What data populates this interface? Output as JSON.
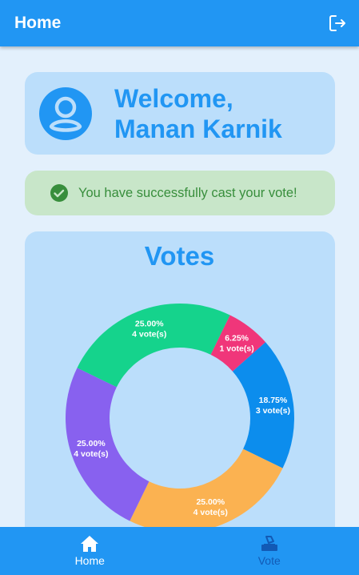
{
  "appbar": {
    "title": "Home",
    "logout_icon": "logout-icon"
  },
  "welcome": {
    "line1": "Welcome,",
    "line2": "Manan Karnik",
    "avatar_icon": "account-circle-icon"
  },
  "status": {
    "message": "You have successfully cast your vote!",
    "icon": "check-circle-icon"
  },
  "votes": {
    "title": "Votes"
  },
  "chart_data": {
    "type": "pie",
    "slices": [
      {
        "percent_label": "25.00%",
        "votes_label": "4 vote(s)",
        "value": 4,
        "color": "#15d38c"
      },
      {
        "percent_label": "6.25%",
        "votes_label": "1 vote(s)",
        "value": 1,
        "color": "#f0367a"
      },
      {
        "percent_label": "18.75%",
        "votes_label": "3 vote(s)",
        "value": 3,
        "color": "#0c8ded"
      },
      {
        "percent_label": "25.00%",
        "votes_label": "4 vote(s)",
        "value": 4,
        "color": "#fbb251"
      },
      {
        "percent_label": "25.00%",
        "votes_label": "4 vote(s)",
        "value": 4,
        "color": "#8861ef"
      }
    ]
  },
  "bottom_nav": {
    "items": [
      {
        "label": "Home",
        "icon": "home-icon",
        "active": true
      },
      {
        "label": "Vote",
        "icon": "ballot-box-icon",
        "active": false
      }
    ]
  },
  "colors": {
    "primary": "#2196f3",
    "card": "#bbdefb",
    "success_bg": "#c8e6c9",
    "success_text": "#388e3c"
  }
}
